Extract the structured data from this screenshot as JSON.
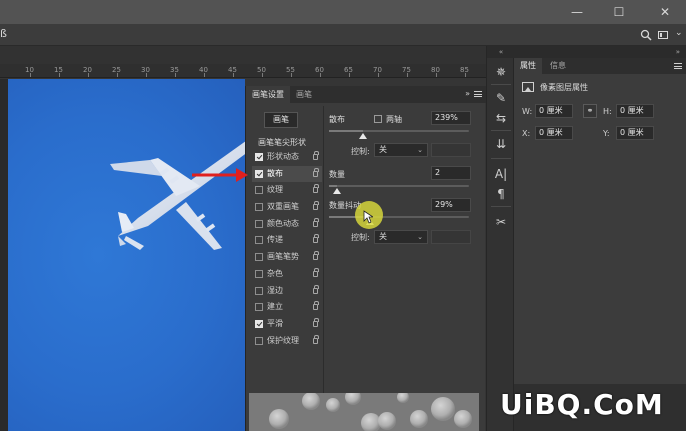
{
  "window": {
    "minimize_glyph": "—",
    "maximize_glyph": "☐",
    "close_glyph": "✕"
  },
  "options_bar": {
    "left_glyph": "ß"
  },
  "ruler": {
    "ticks": [
      "10",
      "15",
      "20",
      "25",
      "30",
      "35",
      "40",
      "45",
      "50",
      "55",
      "60",
      "65",
      "70",
      "75",
      "80",
      "85"
    ]
  },
  "brush_panel": {
    "tabs": [
      "画笔设置",
      "画笔"
    ],
    "collapse_glyph": "»",
    "brushes_button": "画笔",
    "tip_shape_label": "画笔笔尖形状",
    "options": [
      {
        "label": "形状动态",
        "checked": true,
        "selected": false
      },
      {
        "label": "散布",
        "checked": true,
        "selected": true
      },
      {
        "label": "纹理",
        "checked": false,
        "selected": false
      },
      {
        "label": "双重画笔",
        "checked": false,
        "selected": false
      },
      {
        "label": "颜色动态",
        "checked": false,
        "selected": false
      },
      {
        "label": "传递",
        "checked": false,
        "selected": false
      },
      {
        "label": "画笔笔势",
        "checked": false,
        "selected": false
      },
      {
        "label": "杂色",
        "checked": false,
        "selected": false
      },
      {
        "label": "湿边",
        "checked": false,
        "selected": false
      },
      {
        "label": "建立",
        "checked": false,
        "selected": false
      },
      {
        "label": "平滑",
        "checked": true,
        "selected": false
      },
      {
        "label": "保护纹理",
        "checked": false,
        "selected": false
      }
    ],
    "scatter": {
      "label": "散布",
      "both_axes_label": "两轴",
      "both_axes_checked": false,
      "value": "239%",
      "level": 0.24
    },
    "control_label": "控制:",
    "control_value": "关",
    "count": {
      "label": "数量",
      "value": "2",
      "level": 0.06
    },
    "count_jitter": {
      "label": "数量抖动",
      "value": "29%",
      "level": 0.29
    },
    "control2_label": "控制:",
    "control2_value": "关"
  },
  "properties_panel": {
    "tabs": [
      "属性",
      "信息"
    ],
    "top_glyph": "»",
    "section_title": "像素图层属性",
    "w_label": "W:",
    "w_value": "0 厘米",
    "h_label": "H:",
    "h_value": "0 厘米",
    "x_label": "X:",
    "x_value": "0 厘米",
    "y_label": "Y:",
    "y_value": "0 厘米",
    "link_glyph": "⚭"
  },
  "tool_column": {
    "top_glyph": "«",
    "icons": [
      "✵",
      "✎",
      "⇆",
      "⇊",
      "A|",
      "¶",
      "✂"
    ]
  },
  "watermark": "UiBQ.CoM",
  "colors": {
    "sky": "#2a6dcc",
    "panel": "#3b3b3b",
    "arrow": "#e0201e",
    "cursor": "#dcdc3c"
  }
}
